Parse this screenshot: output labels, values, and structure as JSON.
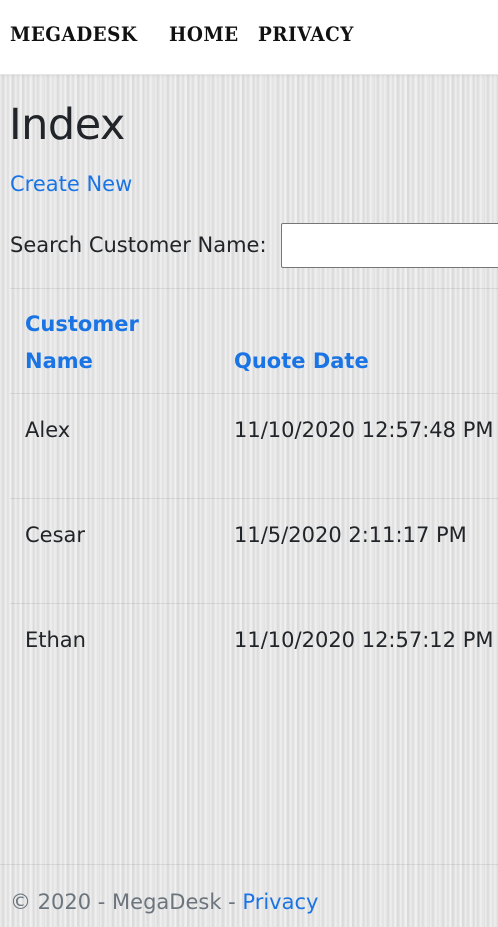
{
  "navbar": {
    "brand": "MEGADESK",
    "links": [
      "HOME",
      "PRIVACY"
    ]
  },
  "main": {
    "title": "Index",
    "create_link": "Create New",
    "search": {
      "label": "Search Customer Name:",
      "value": "",
      "placeholder": ""
    },
    "table": {
      "headers": [
        "Customer Name",
        "Quote Date"
      ],
      "rows": [
        {
          "name": "Alex",
          "date": "11/10/2020 12:57:48 PM"
        },
        {
          "name": "Cesar",
          "date": "11/5/2020 2:11:17 PM"
        },
        {
          "name": "Ethan",
          "date": "11/10/2020 12:57:12 PM"
        }
      ]
    }
  },
  "footer": {
    "text": "© 2020 - MegaDesk - ",
    "link": "Privacy"
  },
  "colors": {
    "link": "#1b74e4",
    "text": "#212529",
    "muted": "#6c757d"
  }
}
